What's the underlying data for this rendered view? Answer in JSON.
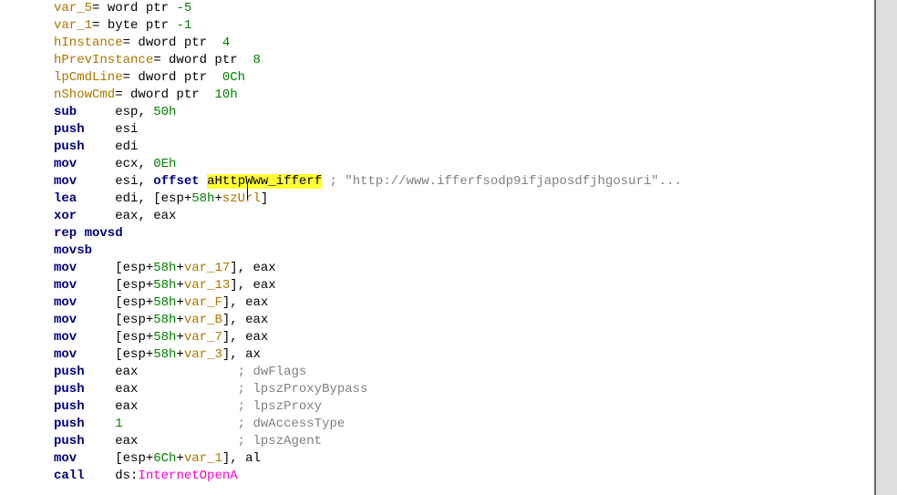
{
  "decl": {
    "var5": "var_5",
    "var5_eq": "= word ptr ",
    "var5_off": "-5",
    "var1": "var_1",
    "var1_eq": "= byte ptr ",
    "var1_off": "-1",
    "hinst": "hInstance",
    "hinst_eq": "= dword ptr  ",
    "hinst_off": "4",
    "hprev": "hPrevInstance",
    "hprev_eq": "= dword ptr  ",
    "hprev_off": "8",
    "lpcmd": "lpCmdLine",
    "lpcmd_eq": "= dword ptr  ",
    "lpcmd_off": "0Ch",
    "nshow": "nShowCmd",
    "nshow_eq": "= dword ptr  ",
    "nshow_off": "10h"
  },
  "empty": "",
  "code": {
    "sub": "sub",
    "sub_op": "esp, ",
    "sub_imm": "50h",
    "push": "push",
    "esi": "esi",
    "edi": "edi",
    "mov": "mov",
    "ecx_op": "ecx, ",
    "ecx_imm": "0Eh",
    "esi_op": "esi, ",
    "offset": "offset",
    "hl_left": "aHtt",
    "hl_right": "pWww_ifferf",
    "url_comment": " ; \"http://www.ifferfsodp9ifjaposdfjhgosuri\"...",
    "lea": "lea",
    "lea_op1": "edi, [esp+",
    "i58h": "58h",
    "plus": "+",
    "szUrl": "szUrl",
    "close": "]",
    "xor": "xor",
    "xor_op": "eax, eax",
    "rep": "rep movsd",
    "movsb": "movsb",
    "var17": "var_17",
    "var13": "var_13",
    "varF": "var_F",
    "varB": "var_B",
    "var7": "var_7",
    "var3": "var_3",
    "var1": "var_1",
    "espop": "[esp+",
    "comma_eax": "], eax",
    "comma_ax": "], ax",
    "comma_al": "], al",
    "eax": "eax",
    "c_dwFlags": "; dwFlags",
    "c_proxybypass": "; lpszProxyBypass",
    "c_proxy": "; lpszProxy",
    "c_access": "; dwAccessType",
    "c_agent": "; lpszAgent",
    "one": "1",
    "i6ch": "6Ch",
    "call": "call",
    "ds": "ds:",
    "apifn": "InternetOpenA"
  }
}
